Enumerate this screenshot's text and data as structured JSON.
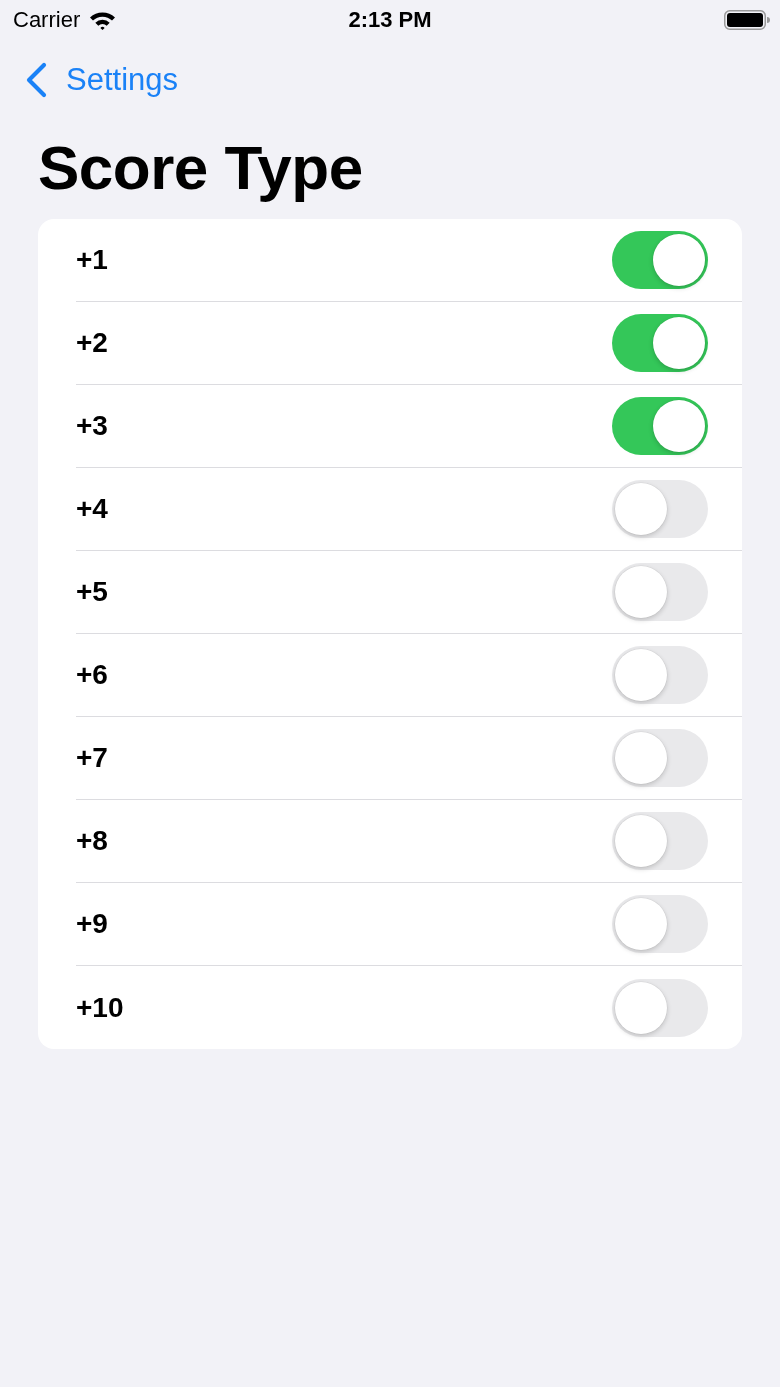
{
  "status_bar": {
    "carrier": "Carrier",
    "time": "2:13 PM"
  },
  "nav": {
    "back_label": "Settings"
  },
  "title": "Score Type",
  "options": [
    {
      "label": "+1",
      "on": true
    },
    {
      "label": "+2",
      "on": true
    },
    {
      "label": "+3",
      "on": true
    },
    {
      "label": "+4",
      "on": false
    },
    {
      "label": "+5",
      "on": false
    },
    {
      "label": "+6",
      "on": false
    },
    {
      "label": "+7",
      "on": false
    },
    {
      "label": "+8",
      "on": false
    },
    {
      "label": "+9",
      "on": false
    },
    {
      "label": "+10",
      "on": false
    }
  ]
}
